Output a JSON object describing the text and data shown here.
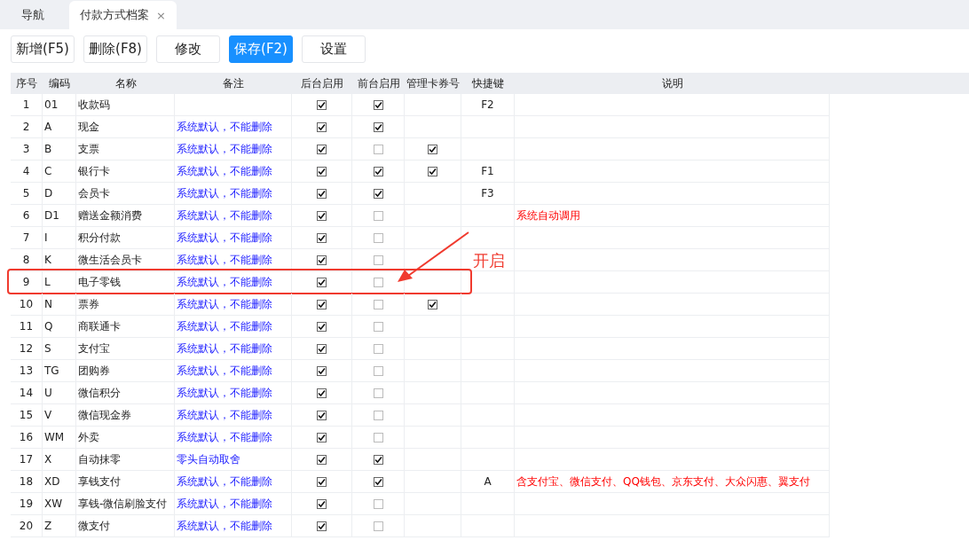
{
  "tabs": [
    {
      "label": "导航",
      "selected": false,
      "closable": false
    },
    {
      "label": "付款方式档案",
      "selected": true,
      "closable": true,
      "close": "×"
    }
  ],
  "toolbar": [
    {
      "label": "新增(F5)",
      "selected": false
    },
    {
      "label": "删除(F8)",
      "selected": false
    },
    {
      "label": "修改",
      "selected": false
    },
    {
      "label": "保存(F2)",
      "selected": true
    },
    {
      "label": "设置",
      "selected": false
    }
  ],
  "table": {
    "columns": [
      "序号",
      "编码",
      "名称",
      "备注",
      "后台启用",
      "前台启用",
      "管理卡券号",
      "快捷键",
      "说明"
    ],
    "rows": [
      {
        "no": "1",
        "code": "01",
        "name": "收款码",
        "remark": "",
        "back": true,
        "front": true,
        "manage_card": false,
        "hotkey": "F2",
        "note": "",
        "highlighted": false
      },
      {
        "no": "2",
        "code": "A",
        "name": "现金",
        "remark": "系统默认，不能删除",
        "back": true,
        "front": true,
        "manage_card": false,
        "hotkey": "",
        "note": "",
        "highlighted": false
      },
      {
        "no": "3",
        "code": "B",
        "name": "支票",
        "remark": "系统默认，不能删除",
        "back": true,
        "front": false,
        "manage_card": true,
        "hotkey": "",
        "note": "",
        "highlighted": false
      },
      {
        "no": "4",
        "code": "C",
        "name": "银行卡",
        "remark": "系统默认，不能删除",
        "back": true,
        "front": true,
        "manage_card": true,
        "hotkey": "F1",
        "note": "",
        "highlighted": false
      },
      {
        "no": "5",
        "code": "D",
        "name": "会员卡",
        "remark": "系统默认，不能删除",
        "back": true,
        "front": true,
        "manage_card": false,
        "hotkey": "F3",
        "note": "",
        "highlighted": false
      },
      {
        "no": "6",
        "code": "D1",
        "name": "赠送金额消费",
        "remark": "系统默认，不能删除",
        "back": true,
        "front": false,
        "manage_card": false,
        "hotkey": "",
        "note": "系统自动调用",
        "highlighted": false
      },
      {
        "no": "7",
        "code": "I",
        "name": "积分付款",
        "remark": "系统默认，不能删除",
        "back": true,
        "front": false,
        "manage_card": false,
        "hotkey": "",
        "note": "",
        "highlighted": false
      },
      {
        "no": "8",
        "code": "K",
        "name": "微生活会员卡",
        "remark": "系统默认，不能删除",
        "back": true,
        "front": false,
        "manage_card": false,
        "hotkey": "",
        "note": "",
        "highlighted": false
      },
      {
        "no": "9",
        "code": "L",
        "name": "电子零钱",
        "remark": "系统默认，不能删除",
        "back": true,
        "front": false,
        "manage_card": false,
        "hotkey": "",
        "note": "",
        "highlighted": true,
        "callout": "开启"
      },
      {
        "no": "10",
        "code": "N",
        "name": "票券",
        "remark": "系统默认，不能删除",
        "back": true,
        "front": false,
        "manage_card": true,
        "hotkey": "",
        "note": "",
        "highlighted": false
      },
      {
        "no": "11",
        "code": "Q",
        "name": "商联通卡",
        "remark": "系统默认，不能删除",
        "back": true,
        "front": false,
        "manage_card": false,
        "hotkey": "",
        "note": "",
        "highlighted": false
      },
      {
        "no": "12",
        "code": "S",
        "name": "支付宝",
        "remark": "系统默认，不能删除",
        "back": true,
        "front": false,
        "manage_card": false,
        "hotkey": "",
        "note": "",
        "highlighted": false
      },
      {
        "no": "13",
        "code": "TG",
        "name": "团购券",
        "remark": "系统默认，不能删除",
        "back": true,
        "front": false,
        "manage_card": false,
        "hotkey": "",
        "note": "",
        "highlighted": false
      },
      {
        "no": "14",
        "code": "U",
        "name": "微信积分",
        "remark": "系统默认，不能删除",
        "back": true,
        "front": false,
        "manage_card": false,
        "hotkey": "",
        "note": "",
        "highlighted": false
      },
      {
        "no": "15",
        "code": "V",
        "name": "微信现金券",
        "remark": "系统默认，不能删除",
        "back": true,
        "front": false,
        "manage_card": false,
        "hotkey": "",
        "note": "",
        "highlighted": false
      },
      {
        "no": "16",
        "code": "WM",
        "name": "外卖",
        "remark": "系统默认，不能删除",
        "back": true,
        "front": false,
        "manage_card": false,
        "hotkey": "",
        "note": "",
        "highlighted": false
      },
      {
        "no": "17",
        "code": "X",
        "name": "自动抹零",
        "remark": "零头自动取舍",
        "back": true,
        "front": true,
        "manage_card": false,
        "hotkey": "",
        "note": "",
        "highlighted": false
      },
      {
        "no": "18",
        "code": "XD",
        "name": "享钱支付",
        "remark": "系统默认，不能删除",
        "back": true,
        "front": true,
        "manage_card": false,
        "hotkey": "A",
        "note": "含支付宝、微信支付、QQ钱包、京东支付、大众闪惠、翼支付",
        "highlighted": false
      },
      {
        "no": "19",
        "code": "XW",
        "name": "享钱-微信刷脸支付",
        "remark": "系统默认，不能删除",
        "back": true,
        "front": false,
        "manage_card": false,
        "hotkey": "",
        "note": "",
        "highlighted": false
      },
      {
        "no": "20",
        "code": "Z",
        "name": "微支付",
        "remark": "系统默认，不能删除",
        "back": true,
        "front": false,
        "manage_card": false,
        "hotkey": "",
        "note": "",
        "highlighted": false
      }
    ]
  }
}
